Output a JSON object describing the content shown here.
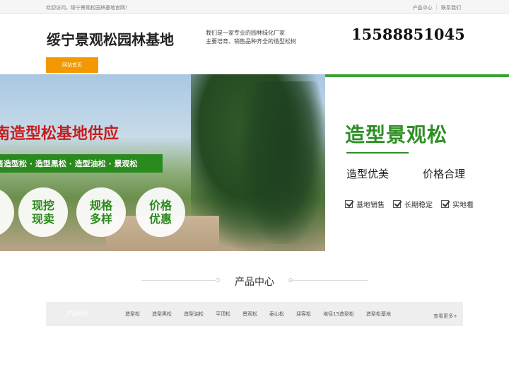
{
  "topbar": {
    "welcome": "欢迎访问，绥宁景观松园林基地官网！",
    "links": [
      "产品中心",
      "联系我们"
    ],
    "separator": "|"
  },
  "header": {
    "logo": "绥宁景观松园林基地",
    "tagline_1": "我们是一家专业的园林绿化厂家",
    "tagline_2": "主要培育、销售品种齐全的造型松树",
    "phone": "15588851045",
    "nav_home": "网站首页"
  },
  "banner": {
    "headline": "南造型松基地供应",
    "greenbar": "售造型松 · 造型黑松 · 造型油松 · 景观松",
    "circles": [
      "",
      "现挖\n现卖",
      "规格\n多样",
      "价格\n优惠"
    ],
    "right_title": "造型景观松",
    "right_sub_1": "造型优美",
    "right_sub_2": "价格合理",
    "checks": [
      "基地销售",
      "长期稳定",
      "实地看"
    ]
  },
  "products": {
    "section_title": "产品中心",
    "category_label": "产品栏目",
    "categories": [
      "造型松",
      "造型黑松",
      "造型油松",
      "平顶松",
      "景观松",
      "泰山松",
      "迎客松",
      "地径15造型松",
      "造型松基地"
    ],
    "more": "查看更多+"
  },
  "colors": {
    "accent_orange": "#f39800",
    "brand_green": "#2e8f25",
    "headline_red": "#c81d1d"
  }
}
